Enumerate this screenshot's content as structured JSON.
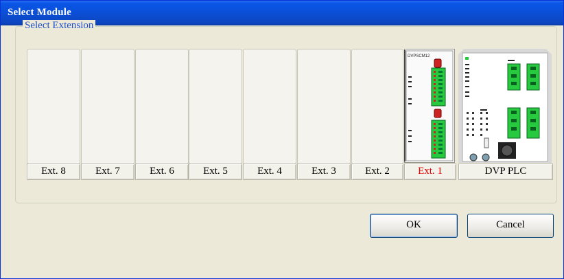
{
  "window": {
    "title": "Select Module"
  },
  "group": {
    "label": "Select Extension"
  },
  "slots": [
    {
      "label": "Ext. 8"
    },
    {
      "label": "Ext. 7"
    },
    {
      "label": "Ext. 6"
    },
    {
      "label": "Ext. 5"
    },
    {
      "label": "Ext. 4"
    },
    {
      "label": "Ext. 3"
    },
    {
      "label": "Ext. 2"
    },
    {
      "label": "Ext. 1",
      "active": true
    },
    {
      "label": "DVP PLC"
    }
  ],
  "module_ext": {
    "model_text": "DVPSCM12"
  },
  "buttons": {
    "ok": "OK",
    "cancel": "Cancel"
  },
  "colors": {
    "active_label": "#e00000",
    "title_bar": "#0b4fd6",
    "terminal_green": "#27c93f"
  }
}
